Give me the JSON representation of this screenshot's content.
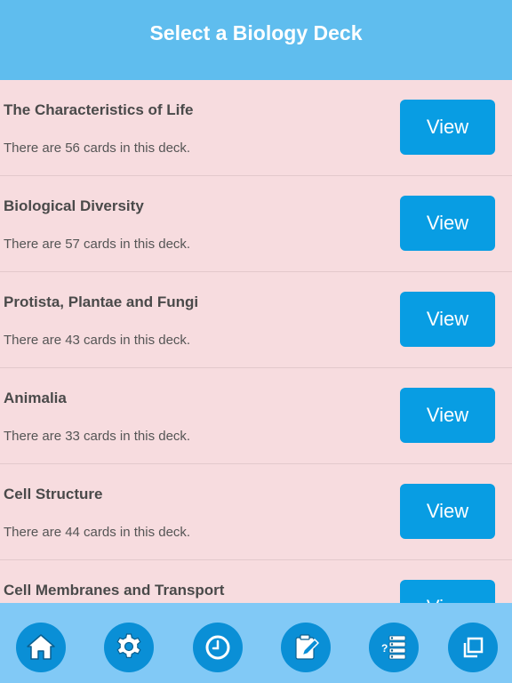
{
  "header": {
    "title": "Select a Biology Deck"
  },
  "decks": [
    {
      "title": "The Characteristics of Life",
      "subtitle": "There are 56 cards in this deck.",
      "button": "View"
    },
    {
      "title": "Biological Diversity",
      "subtitle": "There are 57 cards in this deck.",
      "button": "View"
    },
    {
      "title": "Protista, Plantae and Fungi",
      "subtitle": "There are 43 cards in this deck.",
      "button": "View"
    },
    {
      "title": "Animalia",
      "subtitle": "There are 33 cards in this deck.",
      "button": "View"
    },
    {
      "title": "Cell Structure",
      "subtitle": "There are 44 cards in this deck.",
      "button": "View"
    },
    {
      "title": "Cell Membranes and Transport",
      "subtitle": "",
      "button": "View"
    }
  ],
  "tabbar": {
    "icons": [
      "home-icon",
      "gear-icon",
      "clock-icon",
      "notepad-pencil-icon",
      "quiz-list-icon",
      "copy-icon"
    ]
  },
  "colors": {
    "header": "#5fbdee",
    "list_background": "#f7dcdf",
    "button": "#089de3",
    "tabbar": "#81c9f6",
    "tab_circle": "#0a8fd6"
  }
}
